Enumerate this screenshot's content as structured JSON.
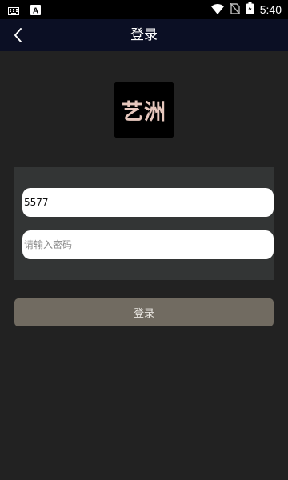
{
  "status_bar": {
    "time": "5:40",
    "icons": [
      "keyboard-icon",
      "app-a-icon",
      "wifi-icon",
      "no-sim-icon",
      "battery-charging-icon"
    ],
    "app_icon_letter": "A"
  },
  "nav": {
    "title": "登录",
    "back_icon": "chevron-left-icon"
  },
  "logo": {
    "text": "艺洲"
  },
  "form": {
    "username_value": "5577",
    "password_value": "",
    "password_placeholder": "请输入密码"
  },
  "actions": {
    "login_label": "登录"
  },
  "colors": {
    "background": "#222222",
    "navbar": "#0b0f24",
    "panel": "#333535",
    "button": "#716b61",
    "logo_text": "#e6c7bd"
  }
}
